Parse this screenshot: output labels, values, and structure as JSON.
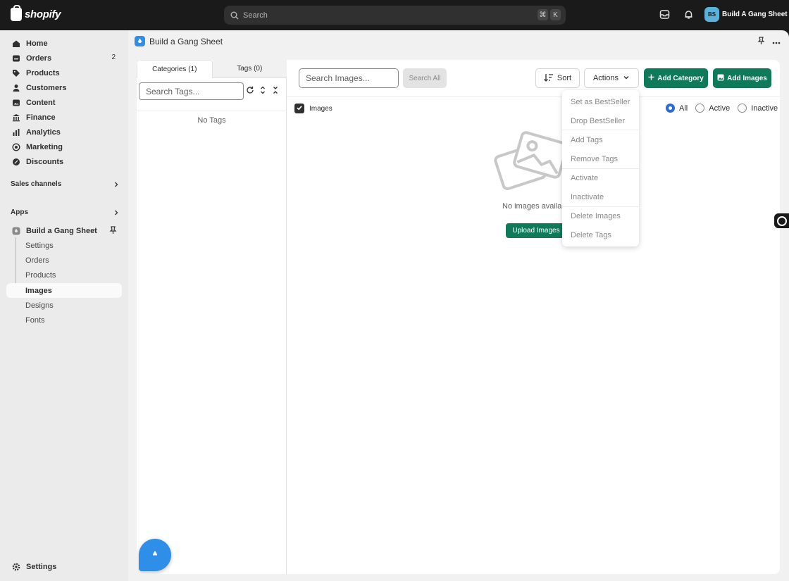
{
  "topbar": {
    "logo_text": "shopify",
    "search_placeholder": "Search",
    "shortcut_keys": [
      "⌘",
      "K"
    ],
    "store_initials": "BS",
    "store_name": "Build A Gang Sheet"
  },
  "sidebar": {
    "items": [
      {
        "label": "Home",
        "icon": "home-icon"
      },
      {
        "label": "Orders",
        "icon": "orders-icon",
        "badge": "2"
      },
      {
        "label": "Products",
        "icon": "tag-icon"
      },
      {
        "label": "Customers",
        "icon": "person-icon"
      },
      {
        "label": "Content",
        "icon": "content-icon"
      },
      {
        "label": "Finance",
        "icon": "bank-icon"
      },
      {
        "label": "Analytics",
        "icon": "analytics-icon"
      },
      {
        "label": "Marketing",
        "icon": "target-icon"
      },
      {
        "label": "Discounts",
        "icon": "discount-icon"
      }
    ],
    "sales_channels_label": "Sales channels",
    "apps_label": "Apps",
    "app_name": "Build a Gang Sheet",
    "app_sub_items": [
      "Settings",
      "Orders",
      "Products",
      "Images",
      "Designs",
      "Fonts"
    ],
    "active_sub_item": "Images",
    "settings_label": "Settings"
  },
  "header": {
    "title": "Build a Gang Sheet"
  },
  "left_panel": {
    "tabs": [
      "Categories (1)",
      "Tags (0)"
    ],
    "active_tab": "Categories (1)",
    "tag_search_placeholder": "Search Tags...",
    "empty_text": "No Tags"
  },
  "toolbar": {
    "image_search_placeholder": "Search Images...",
    "search_all_label": "Search All",
    "sort_label": "Sort",
    "actions_label": "Actions",
    "add_category_label": "Add Category",
    "add_images_label": "Add Images"
  },
  "filter": {
    "select_all_label": "Images",
    "radio_options": [
      "All",
      "Active",
      "Inactive"
    ],
    "selected": "All"
  },
  "empty_state": {
    "text": "No images availab",
    "upload_label": "Upload Images"
  },
  "actions_menu": {
    "groups": [
      [
        "Set as BestSeller",
        "Drop BestSeller"
      ],
      [
        "Add Tags",
        "Remove Tags"
      ],
      [
        "Activate",
        "Inactivate"
      ],
      [
        "Delete Images",
        "Delete Tags"
      ]
    ]
  },
  "colors": {
    "primary_green": "#0f7a5a",
    "app_blue": "#2f8fe8",
    "radio_blue": "#2a6bd8",
    "topbar_bg": "#1a1a1a"
  }
}
